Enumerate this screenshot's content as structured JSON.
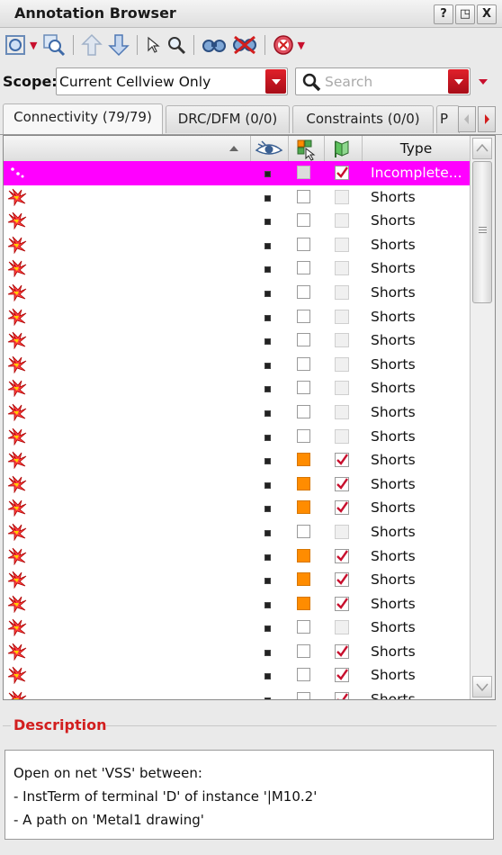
{
  "window": {
    "title": "Annotation Browser",
    "buttons": [
      "?",
      "◳",
      "X"
    ]
  },
  "toolbar": {
    "icons": [
      "zoom-fit-icon",
      "zoom-area-icon",
      "arrow-up-icon",
      "arrow-down-icon",
      "select-pointer-icon",
      "magnifier-icon",
      "binoculars-icon",
      "no-binoculars-icon",
      "stop-icon"
    ]
  },
  "scope": {
    "label": "Scope:",
    "value": "Current Cellview Only",
    "search_placeholder": "Search"
  },
  "tabs": [
    {
      "label": "Connectivity (79/79)",
      "active": true
    },
    {
      "label": "DRC/DFM (0/0)",
      "active": false
    },
    {
      "label": "Constraints (0/0)",
      "active": false
    },
    {
      "label": "P",
      "active": false
    }
  ],
  "table": {
    "columns": {
      "visible_icon": "eye-icon",
      "select_icon": "select-grid-icon",
      "flag_icon": "flag-icon",
      "type": "Type"
    },
    "rows": [
      {
        "icon": "incomplete-net-icon",
        "selectable": "grey",
        "checked": true,
        "type": "Incomplete...",
        "selected": true
      },
      {
        "icon": "short-icon",
        "selectable": "empty",
        "checked": false,
        "type": "Shorts"
      },
      {
        "icon": "short-icon",
        "selectable": "empty",
        "checked": false,
        "type": "Shorts"
      },
      {
        "icon": "short-icon",
        "selectable": "empty",
        "checked": false,
        "type": "Shorts"
      },
      {
        "icon": "short-icon",
        "selectable": "empty",
        "checked": false,
        "type": "Shorts"
      },
      {
        "icon": "short-icon",
        "selectable": "empty",
        "checked": false,
        "type": "Shorts"
      },
      {
        "icon": "short-icon",
        "selectable": "empty",
        "checked": false,
        "type": "Shorts"
      },
      {
        "icon": "short-icon",
        "selectable": "empty",
        "checked": false,
        "type": "Shorts"
      },
      {
        "icon": "short-icon",
        "selectable": "empty",
        "checked": false,
        "type": "Shorts"
      },
      {
        "icon": "short-icon",
        "selectable": "empty",
        "checked": false,
        "type": "Shorts"
      },
      {
        "icon": "short-icon",
        "selectable": "empty",
        "checked": false,
        "type": "Shorts"
      },
      {
        "icon": "short-icon",
        "selectable": "empty",
        "checked": false,
        "type": "Shorts"
      },
      {
        "icon": "short-icon",
        "selectable": "filled",
        "checked": true,
        "type": "Shorts"
      },
      {
        "icon": "short-icon",
        "selectable": "filled",
        "checked": true,
        "type": "Shorts"
      },
      {
        "icon": "short-icon",
        "selectable": "filled",
        "checked": true,
        "type": "Shorts"
      },
      {
        "icon": "short-icon",
        "selectable": "empty",
        "checked": false,
        "type": "Shorts"
      },
      {
        "icon": "short-icon",
        "selectable": "filled",
        "checked": true,
        "type": "Shorts"
      },
      {
        "icon": "short-icon",
        "selectable": "filled",
        "checked": true,
        "type": "Shorts"
      },
      {
        "icon": "short-icon",
        "selectable": "filled",
        "checked": true,
        "type": "Shorts"
      },
      {
        "icon": "short-icon",
        "selectable": "empty",
        "checked": false,
        "type": "Shorts"
      },
      {
        "icon": "short-icon",
        "selectable": "empty",
        "checked": true,
        "type": "Shorts"
      },
      {
        "icon": "short-icon",
        "selectable": "empty",
        "checked": true,
        "type": "Shorts"
      },
      {
        "icon": "short-icon",
        "selectable": "empty",
        "checked": true,
        "type": "Shorts"
      }
    ]
  },
  "description": {
    "label": "Description",
    "lines": [
      "Open on net 'VSS' between:",
      "- InstTerm of terminal 'D' of instance '|M10.2'",
      "- A path on 'Metal1 drawing'"
    ]
  },
  "colors": {
    "selection": "#ff00ff",
    "accent_red": "#d21e1e",
    "fill_orange": "#ff8c00",
    "check_red": "#c8102e"
  }
}
